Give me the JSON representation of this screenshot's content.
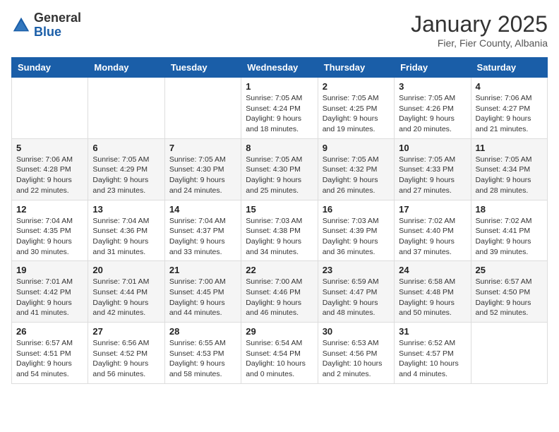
{
  "logo": {
    "general": "General",
    "blue": "Blue"
  },
  "header": {
    "month": "January 2025",
    "location": "Fier, Fier County, Albania"
  },
  "weekdays": [
    "Sunday",
    "Monday",
    "Tuesday",
    "Wednesday",
    "Thursday",
    "Friday",
    "Saturday"
  ],
  "weeks": [
    [
      {
        "day": "",
        "info": ""
      },
      {
        "day": "",
        "info": ""
      },
      {
        "day": "",
        "info": ""
      },
      {
        "day": "1",
        "info": "Sunrise: 7:05 AM\nSunset: 4:24 PM\nDaylight: 9 hours\nand 18 minutes."
      },
      {
        "day": "2",
        "info": "Sunrise: 7:05 AM\nSunset: 4:25 PM\nDaylight: 9 hours\nand 19 minutes."
      },
      {
        "day": "3",
        "info": "Sunrise: 7:05 AM\nSunset: 4:26 PM\nDaylight: 9 hours\nand 20 minutes."
      },
      {
        "day": "4",
        "info": "Sunrise: 7:06 AM\nSunset: 4:27 PM\nDaylight: 9 hours\nand 21 minutes."
      }
    ],
    [
      {
        "day": "5",
        "info": "Sunrise: 7:06 AM\nSunset: 4:28 PM\nDaylight: 9 hours\nand 22 minutes."
      },
      {
        "day": "6",
        "info": "Sunrise: 7:05 AM\nSunset: 4:29 PM\nDaylight: 9 hours\nand 23 minutes."
      },
      {
        "day": "7",
        "info": "Sunrise: 7:05 AM\nSunset: 4:30 PM\nDaylight: 9 hours\nand 24 minutes."
      },
      {
        "day": "8",
        "info": "Sunrise: 7:05 AM\nSunset: 4:30 PM\nDaylight: 9 hours\nand 25 minutes."
      },
      {
        "day": "9",
        "info": "Sunrise: 7:05 AM\nSunset: 4:32 PM\nDaylight: 9 hours\nand 26 minutes."
      },
      {
        "day": "10",
        "info": "Sunrise: 7:05 AM\nSunset: 4:33 PM\nDaylight: 9 hours\nand 27 minutes."
      },
      {
        "day": "11",
        "info": "Sunrise: 7:05 AM\nSunset: 4:34 PM\nDaylight: 9 hours\nand 28 minutes."
      }
    ],
    [
      {
        "day": "12",
        "info": "Sunrise: 7:04 AM\nSunset: 4:35 PM\nDaylight: 9 hours\nand 30 minutes."
      },
      {
        "day": "13",
        "info": "Sunrise: 7:04 AM\nSunset: 4:36 PM\nDaylight: 9 hours\nand 31 minutes."
      },
      {
        "day": "14",
        "info": "Sunrise: 7:04 AM\nSunset: 4:37 PM\nDaylight: 9 hours\nand 33 minutes."
      },
      {
        "day": "15",
        "info": "Sunrise: 7:03 AM\nSunset: 4:38 PM\nDaylight: 9 hours\nand 34 minutes."
      },
      {
        "day": "16",
        "info": "Sunrise: 7:03 AM\nSunset: 4:39 PM\nDaylight: 9 hours\nand 36 minutes."
      },
      {
        "day": "17",
        "info": "Sunrise: 7:02 AM\nSunset: 4:40 PM\nDaylight: 9 hours\nand 37 minutes."
      },
      {
        "day": "18",
        "info": "Sunrise: 7:02 AM\nSunset: 4:41 PM\nDaylight: 9 hours\nand 39 minutes."
      }
    ],
    [
      {
        "day": "19",
        "info": "Sunrise: 7:01 AM\nSunset: 4:42 PM\nDaylight: 9 hours\nand 41 minutes."
      },
      {
        "day": "20",
        "info": "Sunrise: 7:01 AM\nSunset: 4:44 PM\nDaylight: 9 hours\nand 42 minutes."
      },
      {
        "day": "21",
        "info": "Sunrise: 7:00 AM\nSunset: 4:45 PM\nDaylight: 9 hours\nand 44 minutes."
      },
      {
        "day": "22",
        "info": "Sunrise: 7:00 AM\nSunset: 4:46 PM\nDaylight: 9 hours\nand 46 minutes."
      },
      {
        "day": "23",
        "info": "Sunrise: 6:59 AM\nSunset: 4:47 PM\nDaylight: 9 hours\nand 48 minutes."
      },
      {
        "day": "24",
        "info": "Sunrise: 6:58 AM\nSunset: 4:48 PM\nDaylight: 9 hours\nand 50 minutes."
      },
      {
        "day": "25",
        "info": "Sunrise: 6:57 AM\nSunset: 4:50 PM\nDaylight: 9 hours\nand 52 minutes."
      }
    ],
    [
      {
        "day": "26",
        "info": "Sunrise: 6:57 AM\nSunset: 4:51 PM\nDaylight: 9 hours\nand 54 minutes."
      },
      {
        "day": "27",
        "info": "Sunrise: 6:56 AM\nSunset: 4:52 PM\nDaylight: 9 hours\nand 56 minutes."
      },
      {
        "day": "28",
        "info": "Sunrise: 6:55 AM\nSunset: 4:53 PM\nDaylight: 9 hours\nand 58 minutes."
      },
      {
        "day": "29",
        "info": "Sunrise: 6:54 AM\nSunset: 4:54 PM\nDaylight: 10 hours\nand 0 minutes."
      },
      {
        "day": "30",
        "info": "Sunrise: 6:53 AM\nSunset: 4:56 PM\nDaylight: 10 hours\nand 2 minutes."
      },
      {
        "day": "31",
        "info": "Sunrise: 6:52 AM\nSunset: 4:57 PM\nDaylight: 10 hours\nand 4 minutes."
      },
      {
        "day": "",
        "info": ""
      }
    ]
  ]
}
